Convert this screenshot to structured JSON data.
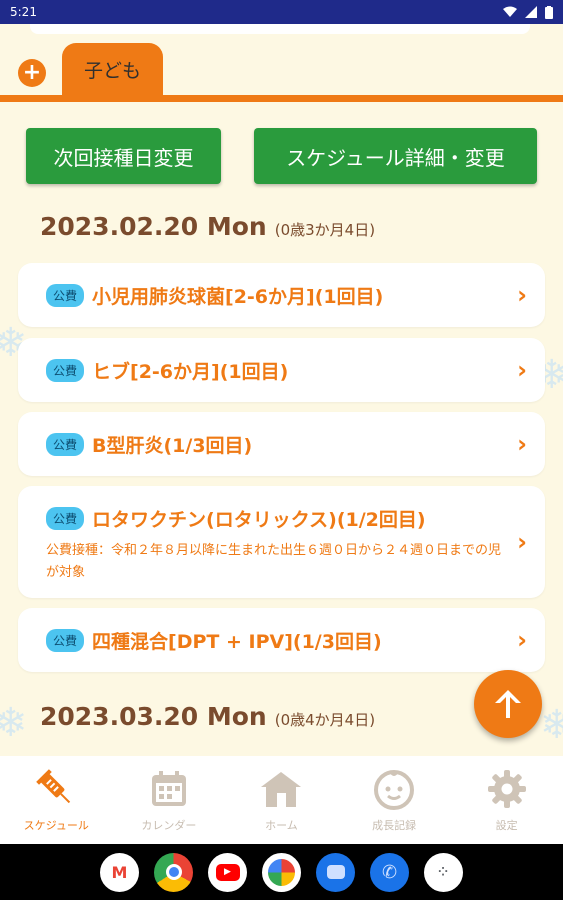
{
  "status_bar": {
    "time": "5:21"
  },
  "tab": {
    "label": "子ども"
  },
  "actions": {
    "next_date_change": "次回接種日変更",
    "schedule_detail": "スケジュール詳細・変更"
  },
  "schedule": [
    {
      "date": "2023.02.20 Mon",
      "age": "(0歳3か月4日)",
      "items": [
        {
          "badge": "公費",
          "name": "小児用肺炎球菌[2-6か月](1回目)",
          "note": ""
        },
        {
          "badge": "公費",
          "name": "ヒブ[2-6か月](1回目)",
          "note": ""
        },
        {
          "badge": "公費",
          "name": "B型肝炎(1/3回目)",
          "note": ""
        },
        {
          "badge": "公費",
          "name": "ロタワクチン(ロタリックス)(1/2回目)",
          "note": "公費接種：令和２年８月以降に生まれた出生６週０日から２４週０日までの児が対象"
        },
        {
          "badge": "公費",
          "name": "四種混合[DPT + IPV](1/3回目)",
          "note": ""
        }
      ]
    },
    {
      "date": "2023.03.20 Mon",
      "age": "(0歳4か月4日)",
      "items": []
    }
  ],
  "bottom_nav": [
    {
      "label": "スケジュール",
      "icon": "syringe-icon",
      "active": true
    },
    {
      "label": "カレンダー",
      "icon": "calendar-icon",
      "active": false
    },
    {
      "label": "ホーム",
      "icon": "home-icon",
      "active": false
    },
    {
      "label": "成長記録",
      "icon": "baby-face-icon",
      "active": false
    },
    {
      "label": "設定",
      "icon": "gear-icon",
      "active": false
    }
  ],
  "dock_apps": [
    "gmail-icon",
    "chrome-icon",
    "youtube-icon",
    "photos-icon",
    "messages-icon",
    "phone-icon",
    "app-drawer-icon"
  ],
  "colors": {
    "accent": "#ef7a15",
    "green": "#2a9b3d",
    "badge": "#4cc4f0",
    "background": "#fdf8e3",
    "status_bar": "#1f2a8a"
  }
}
